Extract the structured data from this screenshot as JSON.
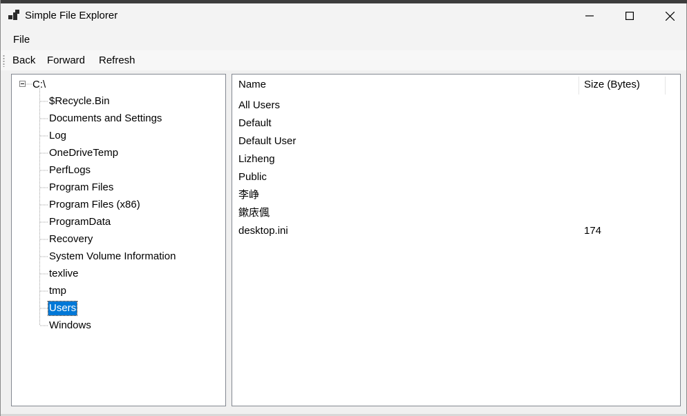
{
  "window": {
    "title": "Simple File Explorer",
    "controls": {
      "minimize": "—",
      "maximize": "☐",
      "close": "✕"
    }
  },
  "menubar": {
    "items": [
      {
        "label": "File"
      }
    ]
  },
  "toolbar": {
    "back": "Back",
    "forward": "Forward",
    "refresh": "Refresh"
  },
  "tree": {
    "root": "C:\\",
    "children": [
      "$Recycle.Bin",
      "Documents and Settings",
      "Log",
      "OneDriveTemp",
      "PerfLogs",
      "Program Files",
      "Program Files (x86)",
      "ProgramData",
      "Recovery",
      "System Volume Information",
      "texlive",
      "tmp",
      "Users",
      "Windows"
    ],
    "selected": "Users"
  },
  "list": {
    "columns": {
      "name": "Name",
      "size": "Size (Bytes)"
    },
    "rows": [
      {
        "name": "All Users",
        "size": ""
      },
      {
        "name": "Default",
        "size": ""
      },
      {
        "name": "Default User",
        "size": ""
      },
      {
        "name": "Lizheng",
        "size": ""
      },
      {
        "name": "Public",
        "size": ""
      },
      {
        "name": "李峥",
        "size": ""
      },
      {
        "name": "鏉庡偑",
        "size": ""
      },
      {
        "name": "desktop.ini",
        "size": "174"
      }
    ]
  },
  "colors": {
    "selection": "#0078d7",
    "border": "#828790"
  }
}
